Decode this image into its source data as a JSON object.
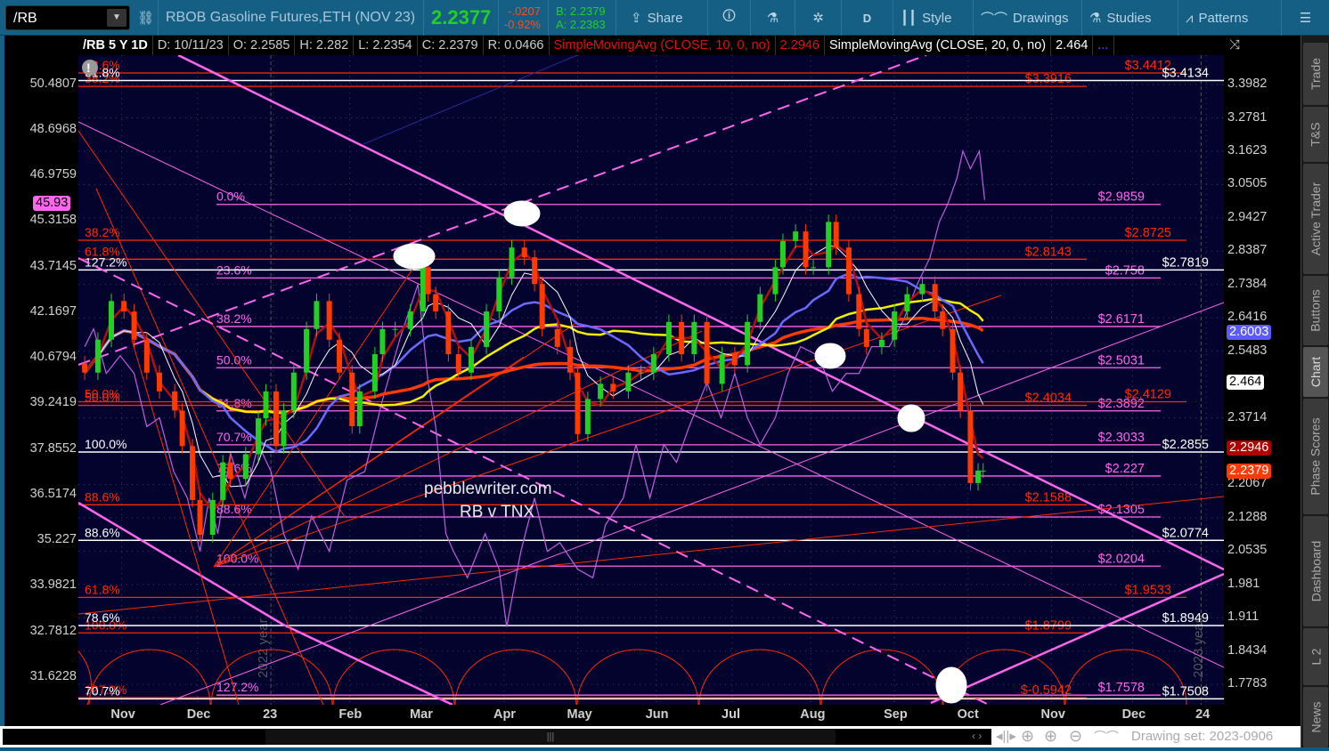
{
  "toolbar": {
    "symbol": "/RB",
    "description": "RBOB Gasoline Futures,ETH (NOV 23)",
    "last": "2.2377",
    "change": "-.0207",
    "change_pct": "-0.92%",
    "bid": "B: 2.2379",
    "ask": "A: 2.2383",
    "share": "Share",
    "aggregation": "D",
    "style": "Style",
    "drawings": "Drawings",
    "studies": "Studies",
    "patterns": "Patterns",
    "icons": [
      "link-icon",
      "share-icon",
      "info-icon",
      "flask-icon",
      "gear-icon",
      "candle-icon",
      "drawings-icon",
      "studies-icon",
      "patterns-icon",
      "menu-icon"
    ]
  },
  "infobar": {
    "title": "/RB 5 Y 1D",
    "date": "D: 10/11/23",
    "open": "O: 2.2585",
    "high": "H: 2.282",
    "low": "L: 2.2354",
    "close": "C: 2.2379",
    "range": "R: 0.0466",
    "sma10_label": "SimpleMovingAvg (CLOSE, 10, 0, no)",
    "sma10_value": "2.2946",
    "sma20_label": "SimpleMovingAvg (CLOSE, 20, 0, no)",
    "sma20_value": "2.464",
    "more": "..."
  },
  "side_tabs": [
    "Trade",
    "T&S",
    "Active Trader",
    "Buttons",
    "Chart",
    "Phase Scores",
    "Dashboard",
    "L 2",
    "News"
  ],
  "bottom": {
    "drawing_set": "Drawing set: 2023-0906"
  },
  "colors": {
    "up": "#22d022",
    "down": "#ff3a00",
    "pink": "#ff66ee",
    "red": "#ff2a00",
    "white": "#ffffff",
    "bg": "#03032e",
    "sma_blue": "#6a6aff",
    "sma_yellow": "#f0f000",
    "sma_red": "#ff3a00",
    "sma_dark": "#b01010",
    "tnx": "#c060e0"
  },
  "chart_data": {
    "type": "candlestick",
    "title": "/RB 5 Y 1D",
    "watermark": [
      "pebblewriter.com",
      "RB v TNX"
    ],
    "year_labels": [
      "2022 year",
      "2023 year"
    ],
    "xlim_days_since_2022_10_15": [
      0,
      452
    ],
    "x_ticks": [
      {
        "label": "Nov",
        "day": 17
      },
      {
        "label": "Dec",
        "day": 47
      },
      {
        "label": "23",
        "day": 77
      },
      {
        "label": "Feb",
        "day": 107
      },
      {
        "label": "Mar",
        "day": 135
      },
      {
        "label": "Apr",
        "day": 168
      },
      {
        "label": "May",
        "day": 197
      },
      {
        "label": "Jun",
        "day": 228
      },
      {
        "label": "Jul",
        "day": 258
      },
      {
        "label": "Aug",
        "day": 289
      },
      {
        "label": "Sep",
        "day": 322
      },
      {
        "label": "Oct",
        "day": 351
      },
      {
        "label": "Nov",
        "day": 384
      },
      {
        "label": "Dec",
        "day": 416
      },
      {
        "label": "24",
        "day": 445
      }
    ],
    "price_axis": {
      "scale": "log",
      "ylim": [
        1.7396,
        3.508
      ],
      "ticks": [
        "3.3982",
        "3.2781",
        "3.1623",
        "3.0505",
        "2.9427",
        "2.8387",
        "2.7384",
        "2.6416",
        "2.5483",
        "2.3714",
        "2.2067",
        "2.1288",
        "2.0535",
        "1.981",
        "1.911",
        "1.8434",
        "1.7783"
      ],
      "badges": [
        {
          "value": "2.6003",
          "bg": "#5a5aff",
          "fg": "#fff"
        },
        {
          "value": "2.464",
          "bg": "#fff",
          "fg": "#000"
        },
        {
          "value": "2.2946",
          "bg": "#b00000",
          "fg": "#fff"
        },
        {
          "value": "2.2379",
          "bg": "#ff3a00",
          "fg": "#fff"
        }
      ]
    },
    "tnx_axis": {
      "scale": "log",
      "ylim": [
        30.94,
        51.65
      ],
      "ticks": [
        "50.4807",
        "48.6968",
        "46.9759",
        "45.3158",
        "43.7145",
        "42.1697",
        "40.6794",
        "39.2419",
        "37.8552",
        "36.5174",
        "35.227",
        "33.9821",
        "32.7812",
        "31.6228"
      ],
      "badge": "45.93"
    },
    "rb_close": [
      [
        2.5,
        2.49
      ],
      [
        7.7,
        2.58
      ],
      [
        13,
        2.69
      ],
      [
        18,
        2.66
      ],
      [
        22,
        2.58
      ],
      [
        27,
        2.49
      ],
      [
        32,
        2.44
      ],
      [
        38,
        2.39
      ],
      [
        41,
        2.3
      ],
      [
        45,
        2.17
      ],
      [
        48,
        2.09
      ],
      [
        53,
        2.17
      ],
      [
        57,
        2.26
      ],
      [
        60,
        2.22
      ],
      [
        66,
        2.28
      ],
      [
        71,
        2.37
      ],
      [
        74,
        2.44
      ],
      [
        78,
        2.3
      ],
      [
        81,
        2.39
      ],
      [
        85,
        2.49
      ],
      [
        90,
        2.61
      ],
      [
        94,
        2.69
      ],
      [
        99,
        2.58
      ],
      [
        103,
        2.49
      ],
      [
        108,
        2.35
      ],
      [
        111,
        2.44
      ],
      [
        117,
        2.54
      ],
      [
        120,
        2.61
      ],
      [
        125,
        2.61
      ],
      [
        131,
        2.66
      ],
      [
        136,
        2.79
      ],
      [
        138,
        2.71
      ],
      [
        141,
        2.66
      ],
      [
        146,
        2.54
      ],
      [
        150,
        2.49
      ],
      [
        155,
        2.56
      ],
      [
        161,
        2.66
      ],
      [
        166,
        2.76
      ],
      [
        171,
        2.85
      ],
      [
        176,
        2.82
      ],
      [
        180,
        2.74
      ],
      [
        183,
        2.61
      ],
      [
        189,
        2.56
      ],
      [
        194,
        2.49
      ],
      [
        197,
        2.33
      ],
      [
        201,
        2.42
      ],
      [
        206,
        2.46
      ],
      [
        211,
        2.44
      ],
      [
        217,
        2.49
      ],
      [
        222,
        2.49
      ],
      [
        227,
        2.54
      ],
      [
        233,
        2.63
      ],
      [
        238,
        2.54
      ],
      [
        243,
        2.63
      ],
      [
        248,
        2.46
      ],
      [
        254,
        2.54
      ],
      [
        259,
        2.51
      ],
      [
        264,
        2.63
      ],
      [
        269,
        2.71
      ],
      [
        275,
        2.79
      ],
      [
        278,
        2.87
      ],
      [
        283,
        2.9
      ],
      [
        287,
        2.79
      ],
      [
        290,
        2.79
      ],
      [
        296,
        2.93
      ],
      [
        299,
        2.85
      ],
      [
        304,
        2.71
      ],
      [
        308,
        2.61
      ],
      [
        311,
        2.56
      ],
      [
        317,
        2.58
      ],
      [
        322,
        2.66
      ],
      [
        327,
        2.71
      ],
      [
        333,
        2.74
      ],
      [
        338,
        2.66
      ],
      [
        341,
        2.61
      ],
      [
        345,
        2.49
      ],
      [
        348,
        2.39
      ],
      [
        352,
        2.21
      ],
      [
        355,
        2.24
      ],
      [
        357,
        2.24
      ]
    ],
    "tnx": [
      [
        2.5,
        41.04
      ],
      [
        6,
        41.62
      ],
      [
        11,
        40.18
      ],
      [
        16.5,
        40.75
      ],
      [
        22,
        40.18
      ],
      [
        27,
        38.53
      ],
      [
        32,
        38.8
      ],
      [
        37.6,
        37.19
      ],
      [
        43,
        36.42
      ],
      [
        48,
        34.92
      ],
      [
        51.6,
        36.42
      ],
      [
        55,
        35.41
      ],
      [
        60,
        37.73
      ],
      [
        65.7,
        36.42
      ],
      [
        71,
        37.99
      ],
      [
        76,
        37.19
      ],
      [
        81,
        35.41
      ],
      [
        86.7,
        34.43
      ],
      [
        92,
        35.91
      ],
      [
        99,
        34.92
      ],
      [
        106,
        36.94
      ],
      [
        113,
        37.19
      ],
      [
        120,
        39.35
      ],
      [
        127,
        41.33
      ],
      [
        134,
        43.11
      ],
      [
        138,
        39.9
      ],
      [
        141,
        38.53
      ],
      [
        145,
        35.41
      ],
      [
        148,
        34.92
      ],
      [
        153.5,
        34.2
      ],
      [
        160.5,
        35.41
      ],
      [
        166,
        34.43
      ],
      [
        169,
        32.9
      ],
      [
        174.6,
        34.92
      ],
      [
        180,
        36.42
      ],
      [
        185,
        34.92
      ],
      [
        190,
        35.16
      ],
      [
        197,
        34.43
      ],
      [
        203,
        34.2
      ],
      [
        208,
        35.66
      ],
      [
        215,
        36.42
      ],
      [
        220,
        37.99
      ],
      [
        225.5,
        36.42
      ],
      [
        231,
        37.99
      ],
      [
        236,
        37.46
      ],
      [
        241,
        38.53
      ],
      [
        248,
        39.9
      ],
      [
        253.6,
        38.8
      ],
      [
        259,
        40.18
      ],
      [
        264,
        38.8
      ],
      [
        269,
        37.99
      ],
      [
        275,
        38.8
      ],
      [
        280,
        40.18
      ],
      [
        285,
        41.04
      ],
      [
        292,
        40.75
      ],
      [
        297.5,
        39.62
      ],
      [
        303,
        40.18
      ],
      [
        308,
        40.18
      ],
      [
        313,
        41.04
      ],
      [
        320,
        41.04
      ],
      [
        325.6,
        41.91
      ],
      [
        331,
        43.11
      ],
      [
        336,
        44.02
      ],
      [
        339.7,
        45.28
      ],
      [
        343,
        45.92
      ],
      [
        346.7,
        46.89
      ],
      [
        349,
        47.89
      ],
      [
        352,
        47.22
      ],
      [
        355.5,
        47.89
      ],
      [
        357.6,
        46.08
      ]
    ],
    "moving_average_windows_days": [
      10,
      20,
      50,
      100,
      200
    ],
    "fib_levels": [
      {
        "set": "pink",
        "pct": "0.0%",
        "price": 2.9859,
        "label": "$2.9859"
      },
      {
        "set": "pink",
        "pct": "23.6%",
        "price": 2.758,
        "label": "$2.758"
      },
      {
        "set": "pink",
        "pct": "38.2%",
        "price": 2.6171,
        "label": "$2.6171"
      },
      {
        "set": "pink",
        "pct": "50.0%",
        "price": 2.5031,
        "label": "$2.5031"
      },
      {
        "set": "pink",
        "pct": "61.8%",
        "price": 2.3892,
        "label": "$2.3892"
      },
      {
        "set": "pink",
        "pct": "70.7%",
        "price": 2.3033,
        "label": "$2.3033"
      },
      {
        "set": "pink",
        "pct": "78.6%",
        "price": 2.227,
        "label": "$2.227"
      },
      {
        "set": "pink",
        "pct": "88.6%",
        "price": 2.1305,
        "label": "$2.1305"
      },
      {
        "set": "pink",
        "pct": "100.0%",
        "price": 2.0204,
        "label": "$2.0204"
      },
      {
        "set": "pink",
        "pct": "127.2%",
        "price": 1.7578,
        "label": "$1.7578"
      },
      {
        "set": "red",
        "pct": "23.6%",
        "price": 3.4412,
        "label": "$3.4412"
      },
      {
        "set": "red",
        "pct": "38.2%",
        "price": 3.3916,
        "label": "$3.3916"
      },
      {
        "set": "red",
        "pct": "38.2%",
        "price": 2.8725,
        "label": "$2.8725"
      },
      {
        "set": "red",
        "pct": "61.8%",
        "price": 2.8143,
        "label": "$2.8143"
      },
      {
        "set": "red",
        "pct": "50.0%",
        "price": 2.4129,
        "label": "$2.4129"
      },
      {
        "set": "red",
        "pct": "50.0%",
        "price": 2.4034,
        "label": "$2.4034"
      },
      {
        "set": "red",
        "pct": "88.6%",
        "price": 2.1588,
        "label": "$2.1588"
      },
      {
        "set": "red",
        "pct": "61.8%",
        "price": 1.9533,
        "label": "$1.9533"
      },
      {
        "set": "red",
        "pct": "100.0%",
        "price": 1.8799,
        "label": "$1.8799"
      },
      {
        "set": "red",
        "pct": "127.2%",
        "price": -0.5942,
        "label": "$-0.5942"
      },
      {
        "set": "white",
        "pct": "61.8%",
        "price": 3.4134,
        "label": "$3.4134"
      },
      {
        "set": "white",
        "pct": "127.2%",
        "price": 2.7819,
        "label": "$2.7819"
      },
      {
        "set": "white",
        "pct": "100.0%",
        "price": 2.2855,
        "label": "$2.2855"
      },
      {
        "set": "white",
        "pct": "88.6%",
        "price": 2.0774,
        "label": "$2.0774"
      },
      {
        "set": "white",
        "pct": "78.6%",
        "price": 1.8949,
        "label": "$1.8949"
      },
      {
        "set": "white",
        "pct": "70.7%",
        "price": 1.7508,
        "label": "$1.7508"
      }
    ]
  }
}
